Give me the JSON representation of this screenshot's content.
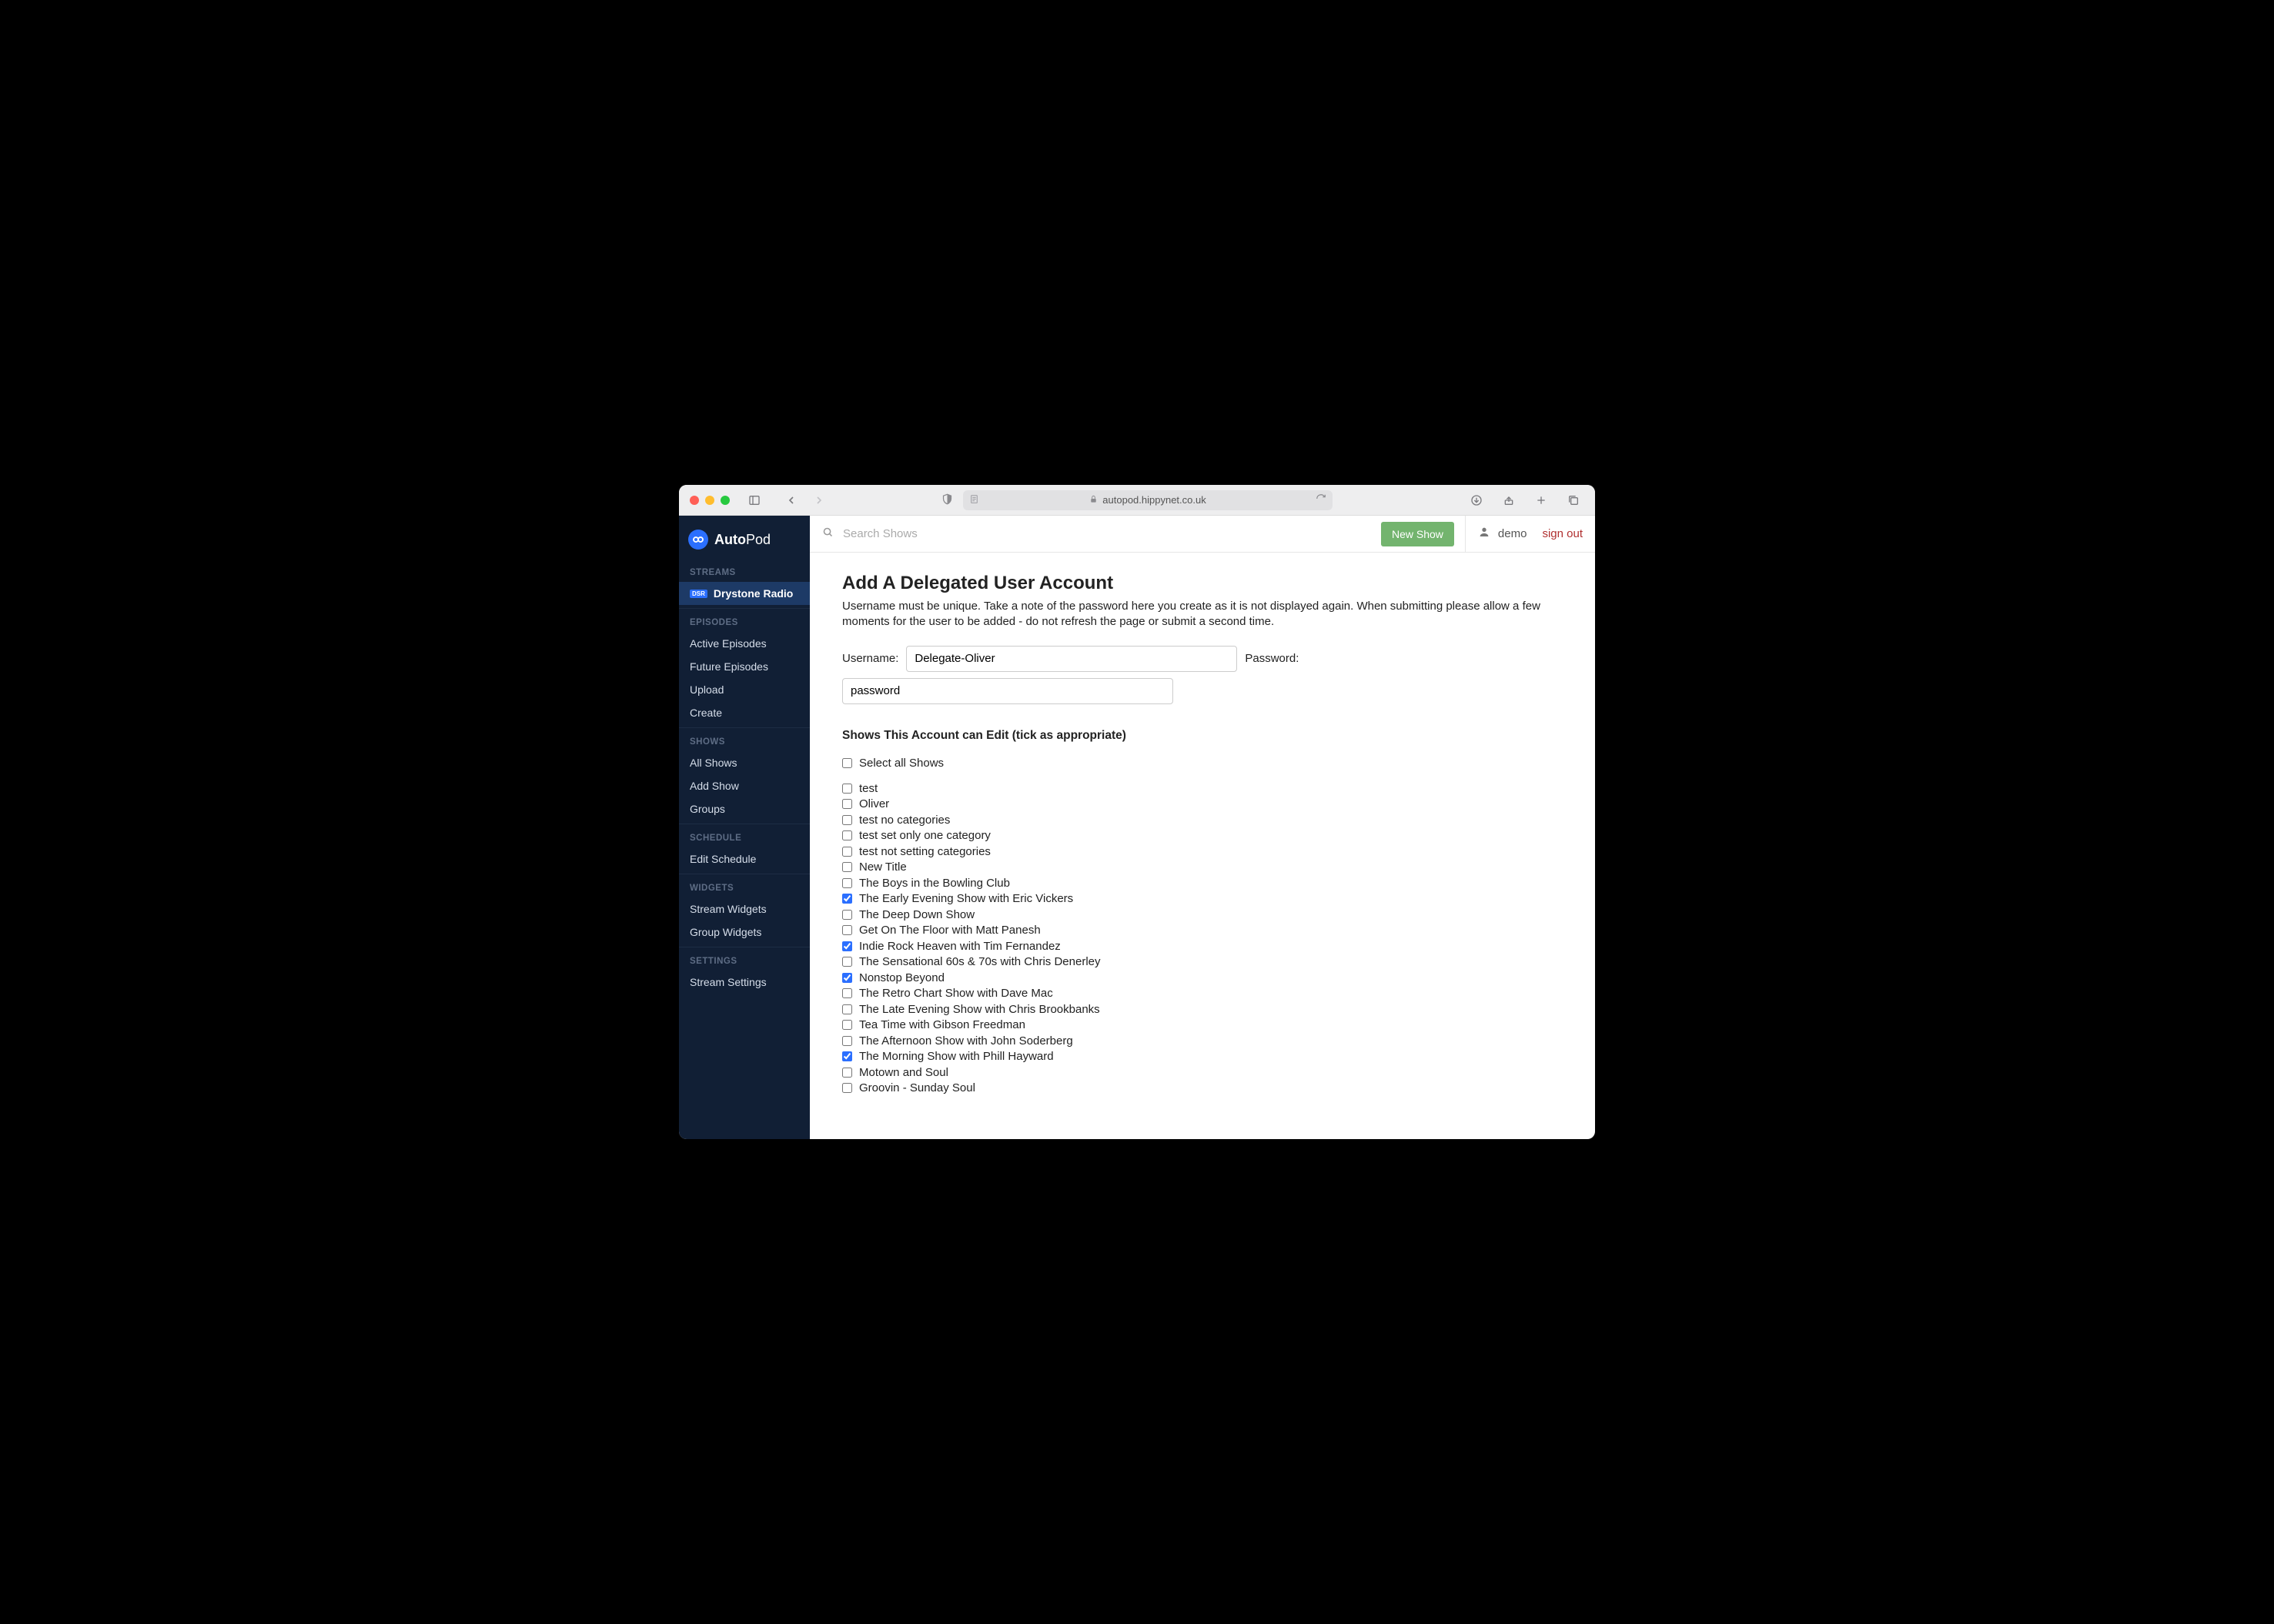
{
  "browser": {
    "url": "autopod.hippynet.co.uk"
  },
  "brand": {
    "name_bold": "Auto",
    "name_light": "Pod"
  },
  "sidebar": {
    "sections": [
      {
        "heading": "STREAMS",
        "items": [
          {
            "label": "Drystone Radio",
            "active": true,
            "badge": "DSR"
          }
        ]
      },
      {
        "heading": "EPISODES",
        "items": [
          {
            "label": "Active Episodes"
          },
          {
            "label": "Future Episodes"
          },
          {
            "label": "Upload"
          },
          {
            "label": "Create"
          }
        ]
      },
      {
        "heading": "SHOWS",
        "items": [
          {
            "label": "All Shows"
          },
          {
            "label": "Add Show"
          },
          {
            "label": "Groups"
          }
        ]
      },
      {
        "heading": "SCHEDULE",
        "items": [
          {
            "label": "Edit Schedule"
          }
        ]
      },
      {
        "heading": "WIDGETS",
        "items": [
          {
            "label": "Stream Widgets"
          },
          {
            "label": "Group Widgets"
          }
        ]
      },
      {
        "heading": "SETTINGS",
        "items": [
          {
            "label": "Stream Settings"
          }
        ]
      }
    ]
  },
  "topbar": {
    "search_placeholder": "Search Shows",
    "new_show": "New Show",
    "username": "demo",
    "signout": "sign out"
  },
  "page": {
    "title": "Add A Delegated User Account",
    "description": "Username must be unique. Take a note of the password here you create as it is not displayed again. When submitting please allow a few moments for the user to be added - do not refresh the page or submit a second time.",
    "username_label": "Username:",
    "username_value": "Delegate-Oliver",
    "password_label": "Password:",
    "password_value": "password",
    "shows_heading": "Shows This Account can Edit (tick as appropriate)",
    "select_all_label": "Select all Shows",
    "shows": [
      {
        "label": "test",
        "checked": false
      },
      {
        "label": "Oliver",
        "checked": false
      },
      {
        "label": "test no categories",
        "checked": false
      },
      {
        "label": "test set only one category",
        "checked": false
      },
      {
        "label": "test not setting categories",
        "checked": false
      },
      {
        "label": "New Title",
        "checked": false
      },
      {
        "label": "The Boys in the Bowling Club",
        "checked": false
      },
      {
        "label": "The Early Evening Show with Eric Vickers",
        "checked": true
      },
      {
        "label": "The Deep Down Show",
        "checked": false
      },
      {
        "label": "Get On The Floor with Matt Panesh",
        "checked": false
      },
      {
        "label": "Indie Rock Heaven with Tim Fernandez",
        "checked": true
      },
      {
        "label": "The Sensational 60s & 70s with Chris Denerley",
        "checked": false
      },
      {
        "label": "Nonstop Beyond",
        "checked": true
      },
      {
        "label": "The Retro Chart Show with Dave Mac",
        "checked": false
      },
      {
        "label": "The Late Evening Show with Chris Brookbanks",
        "checked": false
      },
      {
        "label": "Tea Time with Gibson Freedman",
        "checked": false
      },
      {
        "label": "The Afternoon Show with John Soderberg",
        "checked": false
      },
      {
        "label": "The Morning Show with Phill Hayward",
        "checked": true
      },
      {
        "label": "Motown and Soul",
        "checked": false
      },
      {
        "label": "Groovin - Sunday Soul",
        "checked": false
      }
    ]
  }
}
